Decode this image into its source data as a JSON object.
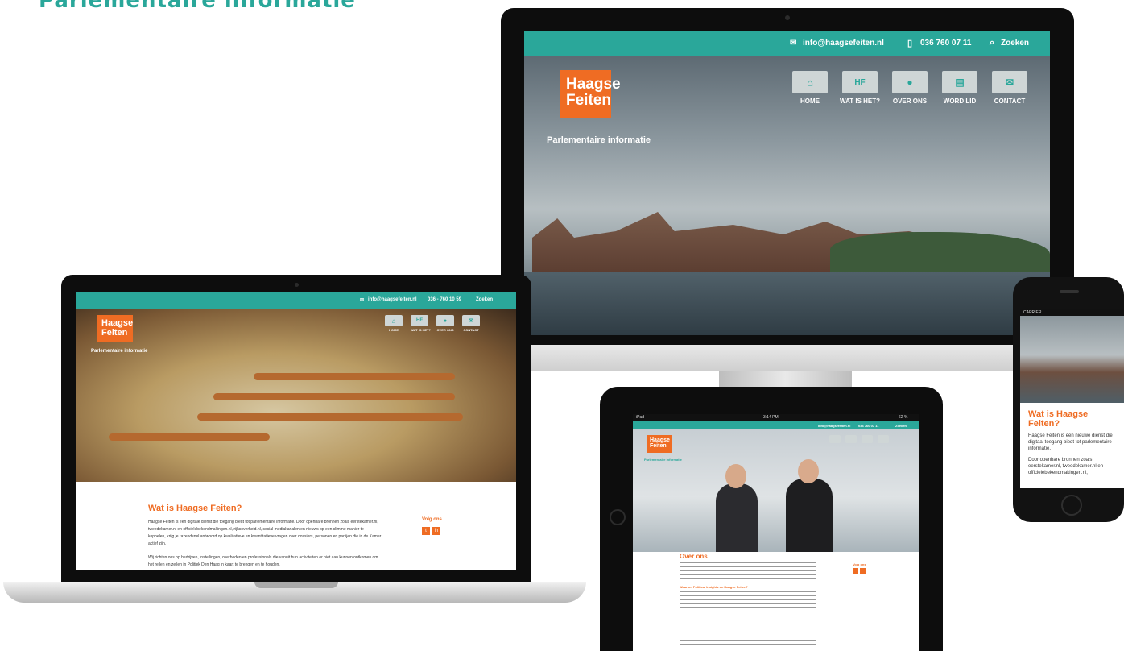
{
  "heading": "Parlementaire informatie",
  "site": {
    "email": "info@haagsefeiten.nl",
    "phone": "036 760 07 11",
    "search": "Zoeken",
    "logo_line1": "Haagse",
    "logo_line2": "Feiten",
    "tagline": "Parlementaire informatie",
    "nav": [
      "HOME",
      "WAT IS HET?",
      "OVER ONS",
      "WORD LID",
      "CONTACT"
    ],
    "hf_tile": "HF"
  },
  "laptop": {
    "email": "info@haagsefeiten.nl",
    "phone": "036 - 760 10 59",
    "search": "Zoeken",
    "nav": [
      "HOME",
      "WAT IS HET?",
      "OVER ONS",
      "CONTACT"
    ],
    "title": "Wat is Haagse Feiten?",
    "para1": "Haagse Feiten is een digitale dienst die toegang biedt tot parlementaire informatie. Door openbare bronnen zoals eerstekamer.nl, tweedekamer.nl en officielebekendmakingen.nl, rijksoverheid.nl, social mediakanalen en nieuws op een slimme manier te koppelen, krijg je razendsnel antwoord op kwalitatieve en kwantitatieve vragen over dossiers, personen en partijen die in de Kamer actief zijn.",
    "para2": "Wij richten ons op bedrijven, instellingen, overheden en professionals die vanuit hun activiteiten er niet aan kunnen ontkomen om het reilen en zeilen in Politiek Den Haag in kaart te brengen en te houden.",
    "follow": "Volg ons"
  },
  "tablet": {
    "status_left": "iPad",
    "status_time": "3:14 PM",
    "status_right": "62 %",
    "title": "Over ons",
    "subtitle": "Waarom Political Insights en Haagse Feiten?",
    "follow": "Volg ons"
  },
  "phone": {
    "carrier": "CARRIER",
    "title_line1": "Wat is Haagse",
    "title_line2": "Feiten?",
    "para1": "Haagse Feiten is een nieuwe dienst die digitaal toegang biedt tot parlementaire informatie.",
    "para2": "Door openbare bronnen zoals eerstekamer.nl, tweedekamer.nl en officielebekendmakingen.nl,"
  },
  "colors": {
    "teal": "#2aa79a",
    "orange": "#ef6c23"
  }
}
